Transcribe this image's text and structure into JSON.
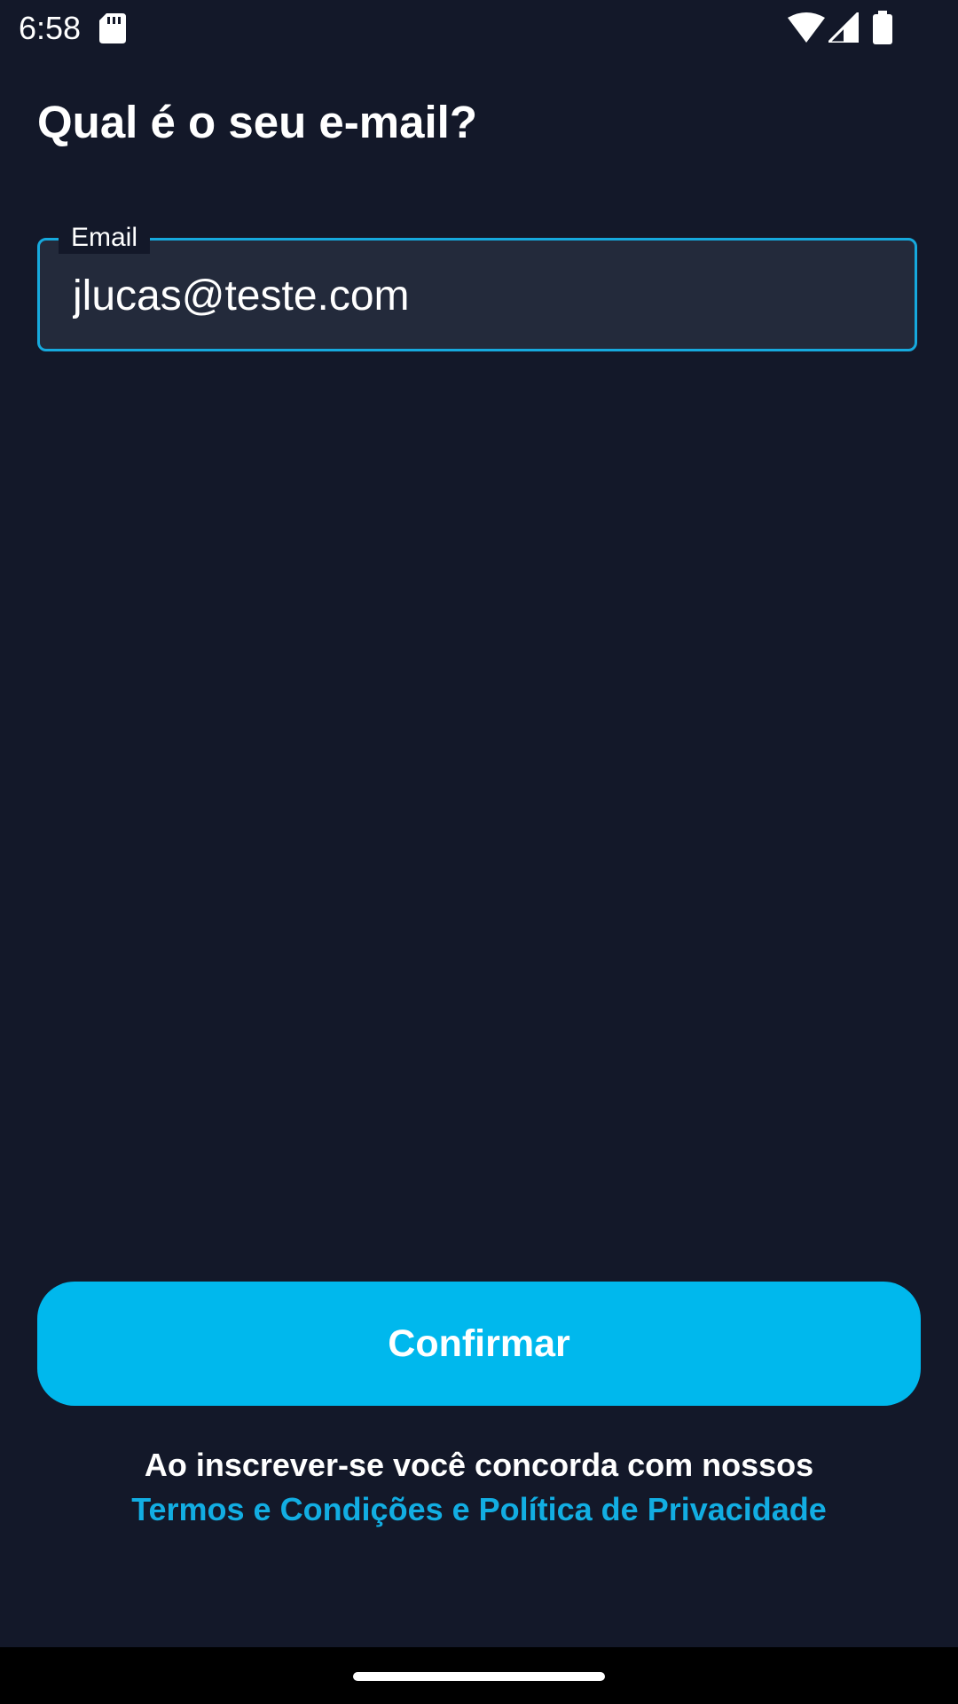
{
  "status_bar": {
    "time": "6:58",
    "icons": [
      "sd-card-icon",
      "wifi-icon",
      "signal-icon",
      "battery-icon"
    ]
  },
  "page": {
    "title": "Qual é o seu e-mail?"
  },
  "email_field": {
    "label": "Email",
    "value": "jlucas@teste.com"
  },
  "confirm_button": {
    "label": "Confirmar"
  },
  "terms": {
    "text": "Ao inscrever-se você concorda com nossos",
    "link": "Termos e Condições e Política de Privacidade"
  },
  "colors": {
    "background": "#131829",
    "accent": "#00b8ed",
    "field_background": "#232a3b",
    "field_border": "#16a9dd",
    "link": "#12ade2"
  }
}
